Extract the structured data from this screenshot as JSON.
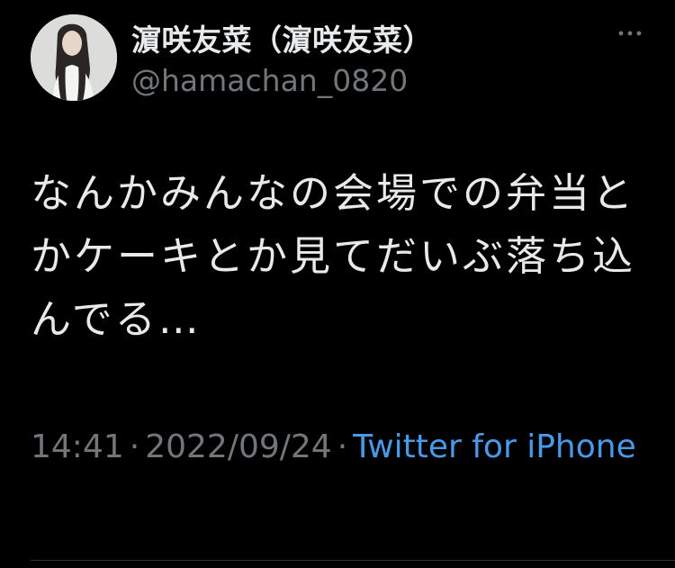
{
  "tweet": {
    "author": {
      "display_name": "濵咲友菜（濵咲友菜）",
      "handle": "@hamachan_0820",
      "avatar_icon": "profile-photo-avatar"
    },
    "more_icon": "more-options-icon",
    "text": "なんかみんなの会場での弁当とかケーキとか見てだいぶ落ち込んでる…",
    "time": "14:41",
    "date": "2022/09/24",
    "separator": "·",
    "source": "Twitter for iPhone"
  },
  "colors": {
    "background": "#000000",
    "primary_text": "#e7e9ea",
    "secondary_text": "#71767b",
    "link": "#4a99e9",
    "divider": "#2f3336"
  }
}
